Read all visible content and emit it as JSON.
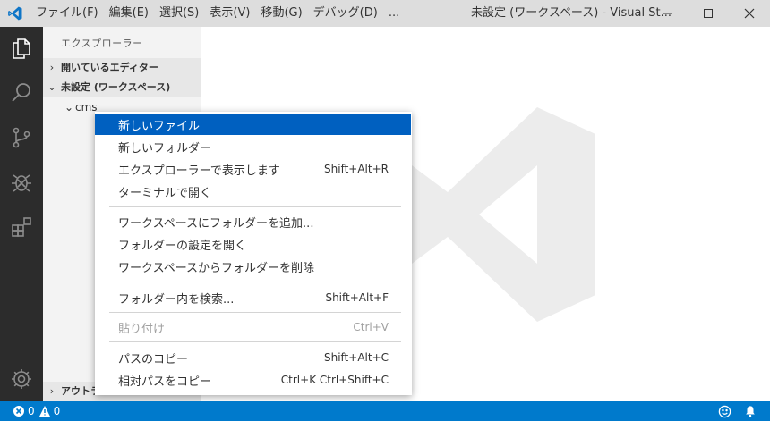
{
  "titlebar": {
    "menu": [
      {
        "label": "ファイル(F)"
      },
      {
        "label": "編集(E)"
      },
      {
        "label": "選択(S)"
      },
      {
        "label": "表示(V)"
      },
      {
        "label": "移動(G)"
      },
      {
        "label": "デバッグ(D)"
      },
      {
        "label": "..."
      }
    ],
    "window_title": "未設定 (ワークスペース) - Visual St..."
  },
  "activity_bar": {
    "icons": [
      "files-icon",
      "search-icon",
      "source-control-icon",
      "debug-icon",
      "extensions-icon",
      "settings-gear-icon"
    ]
  },
  "sidebar": {
    "title": "エクスプローラー",
    "sections": {
      "open_editors": "開いているエディター",
      "workspace": "未設定 (ワークスペース)",
      "outline": "アウトライン"
    },
    "tree": {
      "folder": "cms"
    }
  },
  "context_menu": {
    "items": [
      {
        "label": "新しいファイル",
        "shortcut": ""
      },
      {
        "label": "新しいフォルダー",
        "shortcut": ""
      },
      {
        "label": "エクスプローラーで表示します",
        "shortcut": "Shift+Alt+R"
      },
      {
        "label": "ターミナルで開く",
        "shortcut": ""
      },
      {
        "label": "ワークスペースにフォルダーを追加...",
        "shortcut": ""
      },
      {
        "label": "フォルダーの設定を開く",
        "shortcut": ""
      },
      {
        "label": "ワークスペースからフォルダーを削除",
        "shortcut": ""
      },
      {
        "label": "フォルダー内を検索...",
        "shortcut": "Shift+Alt+F"
      },
      {
        "label": "貼り付け",
        "shortcut": "Ctrl+V"
      },
      {
        "label": "パスのコピー",
        "shortcut": "Shift+Alt+C"
      },
      {
        "label": "相対パスをコピー",
        "shortcut": "Ctrl+K Ctrl+Shift+C"
      }
    ]
  },
  "statusbar": {
    "errors": "0",
    "warnings": "0"
  },
  "colors": {
    "accent": "#007acc",
    "menu_highlight": "#0060c0",
    "activity_bar": "#2c2c2c",
    "titlebar": "#dddddd"
  }
}
